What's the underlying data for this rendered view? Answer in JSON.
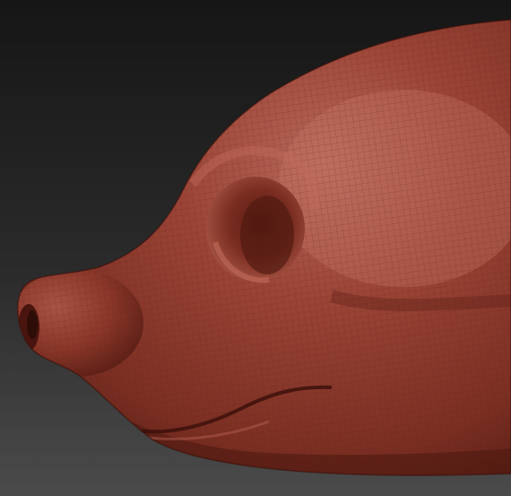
{
  "scene": {
    "subject": "sculpted-animal-head-side-view",
    "colors": {
      "background_top": "#1a1a1a",
      "background_bottom": "#4a4a4a",
      "clay_base": "#8f3a2c",
      "clay_light": "#b56050",
      "clay_shadow": "#4d1710",
      "wire": "#6e2a20"
    }
  }
}
